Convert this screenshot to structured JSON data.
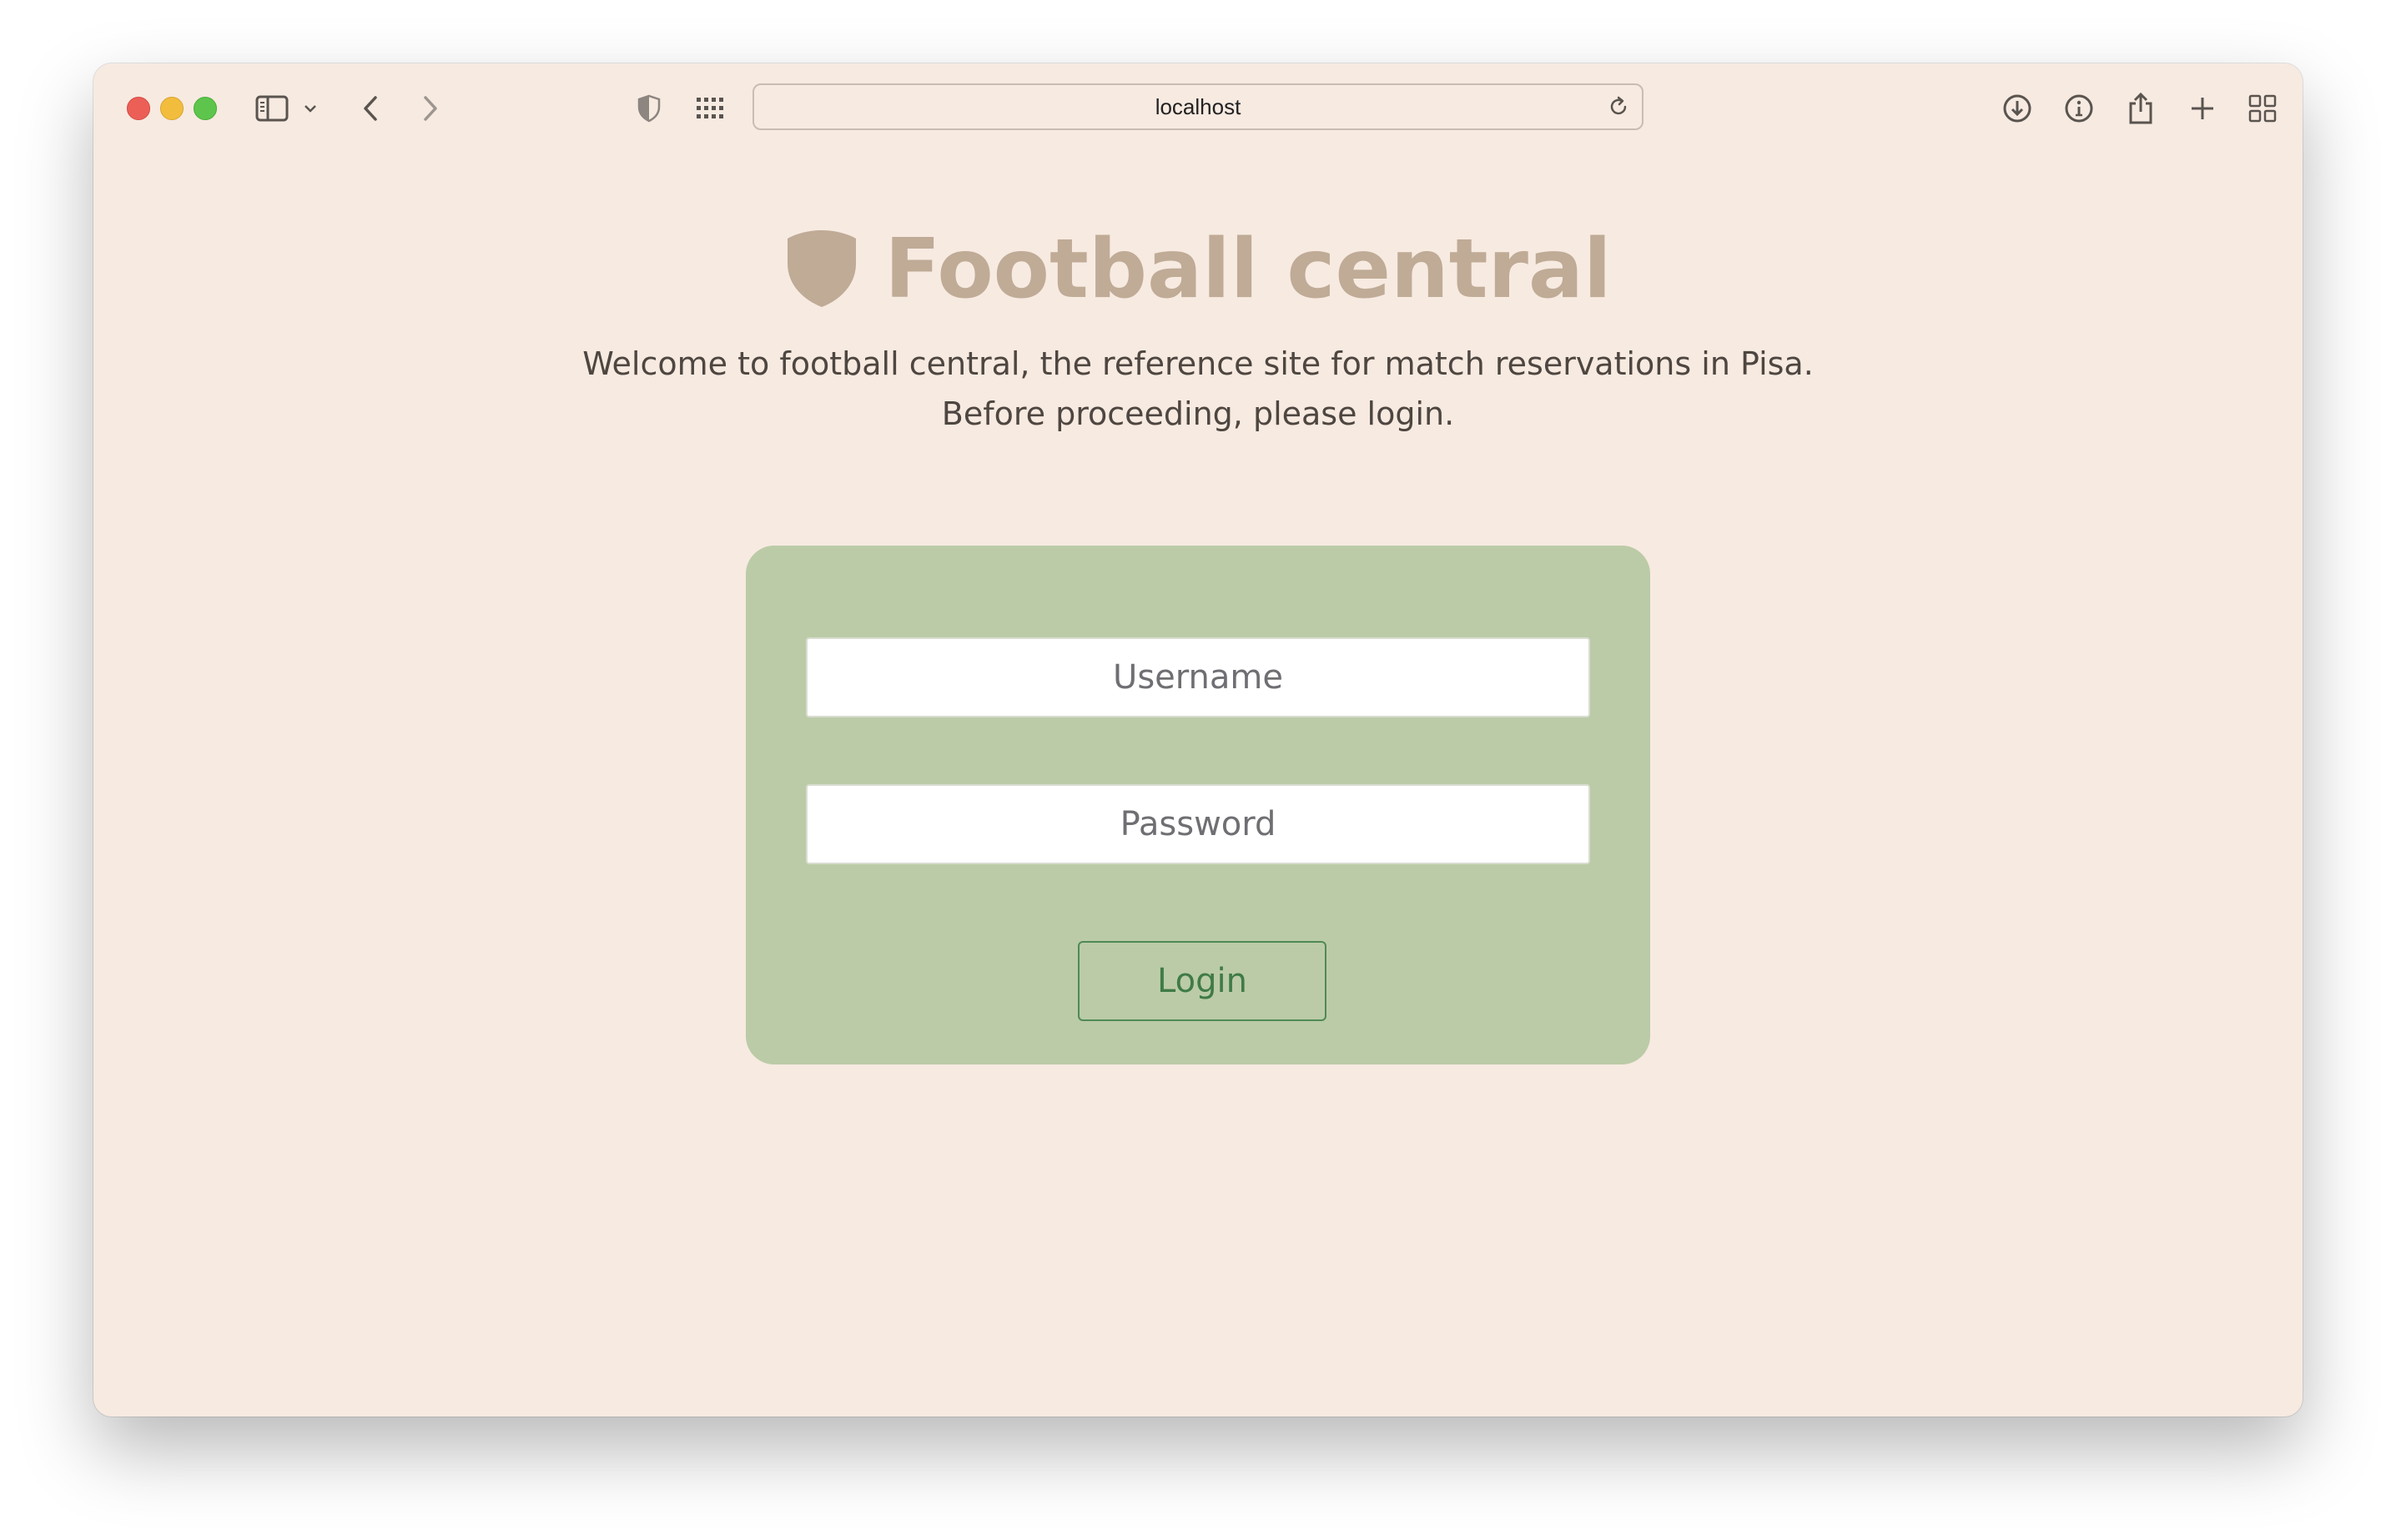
{
  "browser": {
    "url": "localhost",
    "icons": {
      "sidebar": "sidebar-icon",
      "sidebar_menu": "chevron-down-icon",
      "back": "chevron-left-icon",
      "forward": "chevron-right-icon",
      "privacy": "shield-icon",
      "extensions": "grid-dots-icon",
      "reload": "reload-icon",
      "downloads": "download-icon",
      "info": "info-icon",
      "share": "share-icon",
      "new_tab": "plus-icon",
      "tab_overview": "tabs-grid-icon"
    },
    "colors": {
      "close": "#ec5f57",
      "minimize": "#f2bd3d",
      "zoom": "#5ec54c"
    }
  },
  "page": {
    "brand": {
      "logo_icon": "shield-icon",
      "title": "Football central",
      "color": "#bfab96"
    },
    "subtitle_line1": "Welcome to football central, the reference site for match reservations in Pisa.",
    "subtitle_line2": "Before proceeding, please login.",
    "background": "#f7eae1"
  },
  "login_form": {
    "background": "#bbcba7",
    "username_placeholder": "Username",
    "username_value": "",
    "password_placeholder": "Password",
    "password_value": "",
    "submit_label": "Login",
    "accent": "#3f7b46"
  }
}
